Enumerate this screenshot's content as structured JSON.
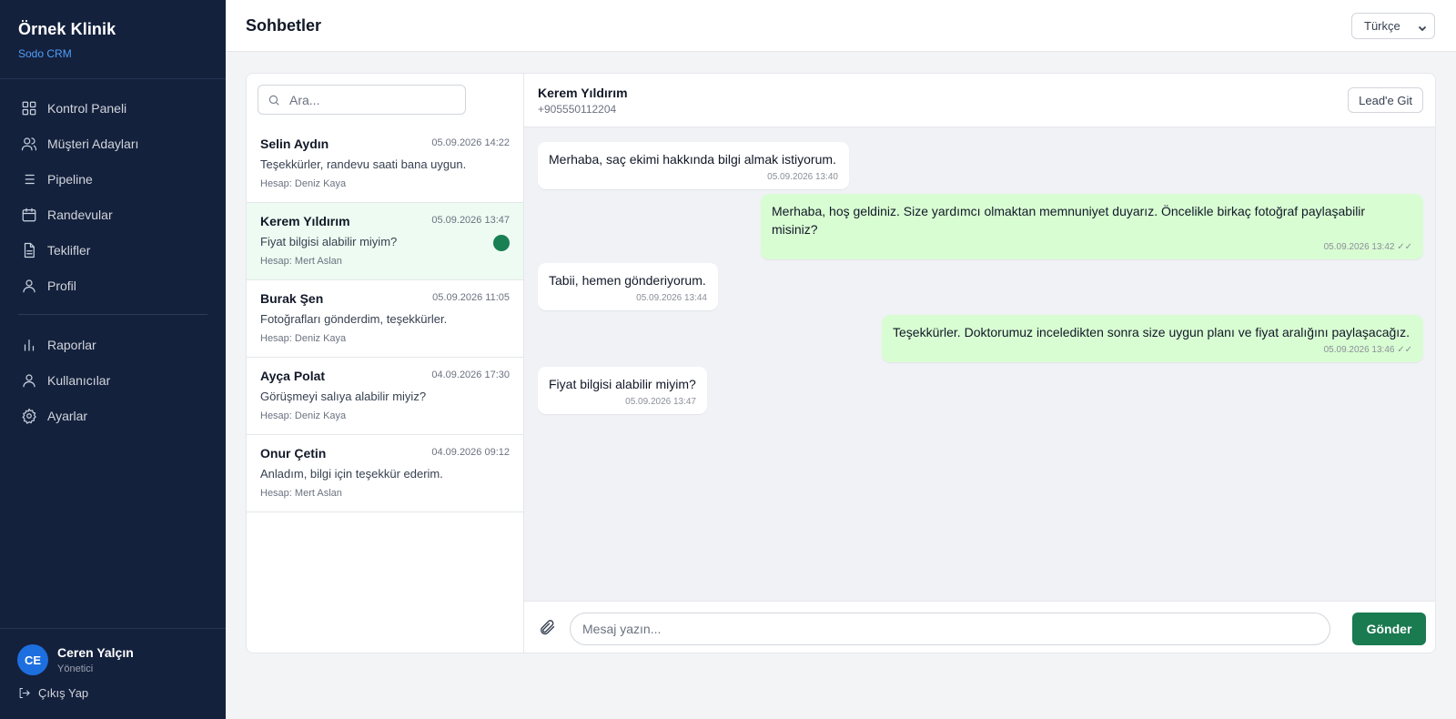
{
  "sidebar": {
    "brand_name": "Örnek Klinik",
    "brand_sub": "Sodo CRM",
    "items": [
      {
        "label": "Kontrol Paneli",
        "icon": "grid-icon"
      },
      {
        "label": "Müşteri Adayları",
        "icon": "users-icon"
      },
      {
        "label": "Pipeline",
        "icon": "list-icon"
      },
      {
        "label": "Randevular",
        "icon": "calendar-icon"
      },
      {
        "label": "Teklifler",
        "icon": "document-icon"
      },
      {
        "label": "Profil",
        "icon": "user-icon"
      }
    ],
    "items_secondary": [
      {
        "label": "Raporlar",
        "icon": "bar-chart-icon"
      },
      {
        "label": "Kullanıcılar",
        "icon": "user-icon"
      },
      {
        "label": "Ayarlar",
        "icon": "gear-icon"
      }
    ],
    "user": {
      "initials": "CE",
      "name": "Ceren Yalçın",
      "role": "Yönetici"
    },
    "logout_label": "Çıkış Yap"
  },
  "header": {
    "title": "Sohbetler",
    "language": "Türkçe"
  },
  "conversations": {
    "search_placeholder": "Ara...",
    "items": [
      {
        "name": "Selin Aydın",
        "time": "05.09.2026 14:22",
        "message": "Teşekkürler, randevu saati bana uygun.",
        "account": "Hesap: Deniz Kaya",
        "active": false,
        "unread": false
      },
      {
        "name": "Kerem Yıldırım",
        "time": "05.09.2026 13:47",
        "message": "Fiyat bilgisi alabilir miyim?",
        "account": "Hesap: Mert Aslan",
        "active": true,
        "unread": true
      },
      {
        "name": "Burak Şen",
        "time": "05.09.2026 11:05",
        "message": "Fotoğrafları gönderdim, teşekkürler.",
        "account": "Hesap: Deniz Kaya",
        "active": false,
        "unread": false
      },
      {
        "name": "Ayça Polat",
        "time": "04.09.2026 17:30",
        "message": "Görüşmeyi salıya alabilir miyiz?",
        "account": "Hesap: Deniz Kaya",
        "active": false,
        "unread": false
      },
      {
        "name": "Onur Çetin",
        "time": "04.09.2026 09:12",
        "message": "Anladım, bilgi için teşekkür ederim.",
        "account": "Hesap: Mert Aslan",
        "active": false,
        "unread": false
      }
    ]
  },
  "thread": {
    "contact_name": "Kerem Yıldırım",
    "contact_phone": "+905550112204",
    "lead_button": "Lead'e Git",
    "messages": [
      {
        "direction": "in",
        "text": "Merhaba, saç ekimi hakkında bilgi almak istiyorum.",
        "time": "05.09.2026 13:40"
      },
      {
        "direction": "out",
        "text": "Merhaba, hoş geldiniz. Size yardımcı olmaktan memnuniyet duyarız. Öncelikle birkaç fotoğraf paylaşabilir misiniz?",
        "time": "05.09.2026 13:42 ✓✓"
      },
      {
        "direction": "in",
        "text": "Tabii, hemen gönderiyorum.",
        "time": "05.09.2026 13:44"
      },
      {
        "direction": "out",
        "text": "Teşekkürler. Doktorumuz inceledikten sonra size uygun planı ve fiyat aralığını paylaşacağız.",
        "time": "05.09.2026 13:46 ✓✓"
      },
      {
        "direction": "in",
        "text": "Fiyat bilgisi alabilir miyim?",
        "time": "05.09.2026 13:47"
      }
    ],
    "composer_placeholder": "Mesaj yazın...",
    "send_label": "Gönder"
  },
  "colors": {
    "sidebar_bg": "#14213d",
    "accent_green": "#1a7a50",
    "outgoing_bubble": "#d9fdd3",
    "active_conv_bg": "#edfbf2",
    "brand_sub": "#4f9ef8",
    "avatar_bg": "#1d6fe0"
  }
}
